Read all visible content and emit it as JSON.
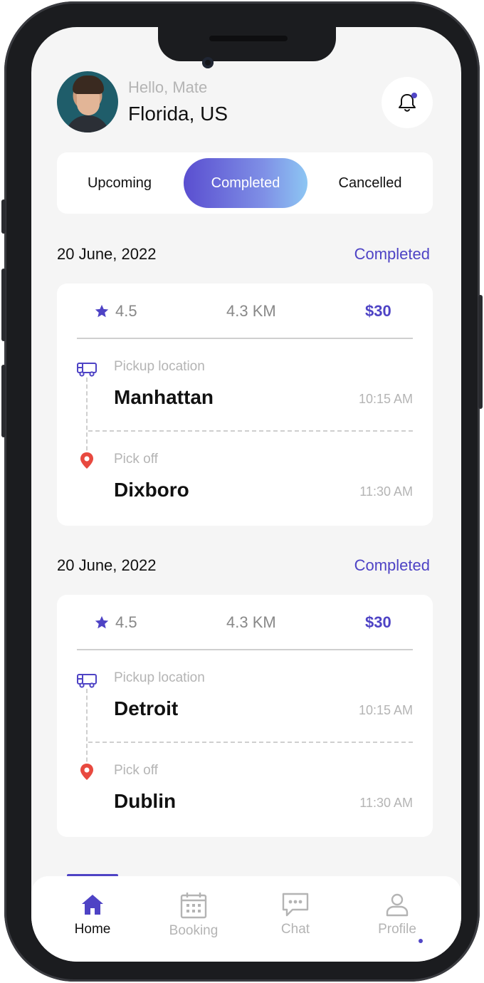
{
  "header": {
    "greeting": "Hello, Mate",
    "location": "Florida, US",
    "avatar_icon": "user-avatar",
    "bell_icon": "bell-icon"
  },
  "tabs": [
    {
      "label": "Upcoming",
      "active": false
    },
    {
      "label": "Completed",
      "active": true
    },
    {
      "label": "Cancelled",
      "active": false
    }
  ],
  "rides": [
    {
      "date": "20 June, 2022",
      "status": "Completed",
      "rating": "4.5",
      "distance": "4.3 KM",
      "price": "$30",
      "pickup_label": "Pickup location",
      "pickup_name": "Manhattan",
      "pickup_time": "10:15 AM",
      "dropoff_label": "Pick off",
      "dropoff_name": "Dixboro",
      "dropoff_time": "11:30 AM"
    },
    {
      "date": "20 June, 2022",
      "status": "Completed",
      "rating": "4.5",
      "distance": "4.3 KM",
      "price": "$30",
      "pickup_label": "Pickup location",
      "pickup_name": "Detroit",
      "pickup_time": "10:15 AM",
      "dropoff_label": "Pick off",
      "dropoff_name": "Dublin",
      "dropoff_time": "11:30 AM"
    }
  ],
  "nav": [
    {
      "label": "Home",
      "icon": "home-icon",
      "active": true
    },
    {
      "label": "Booking",
      "icon": "calendar-icon",
      "active": false
    },
    {
      "label": "Chat",
      "icon": "chat-icon",
      "active": false
    },
    {
      "label": "Profile",
      "icon": "user-icon",
      "active": false
    }
  ],
  "colors": {
    "accent": "#4e43c5",
    "pin": "#e8493f",
    "background": "#f5f5f5"
  }
}
